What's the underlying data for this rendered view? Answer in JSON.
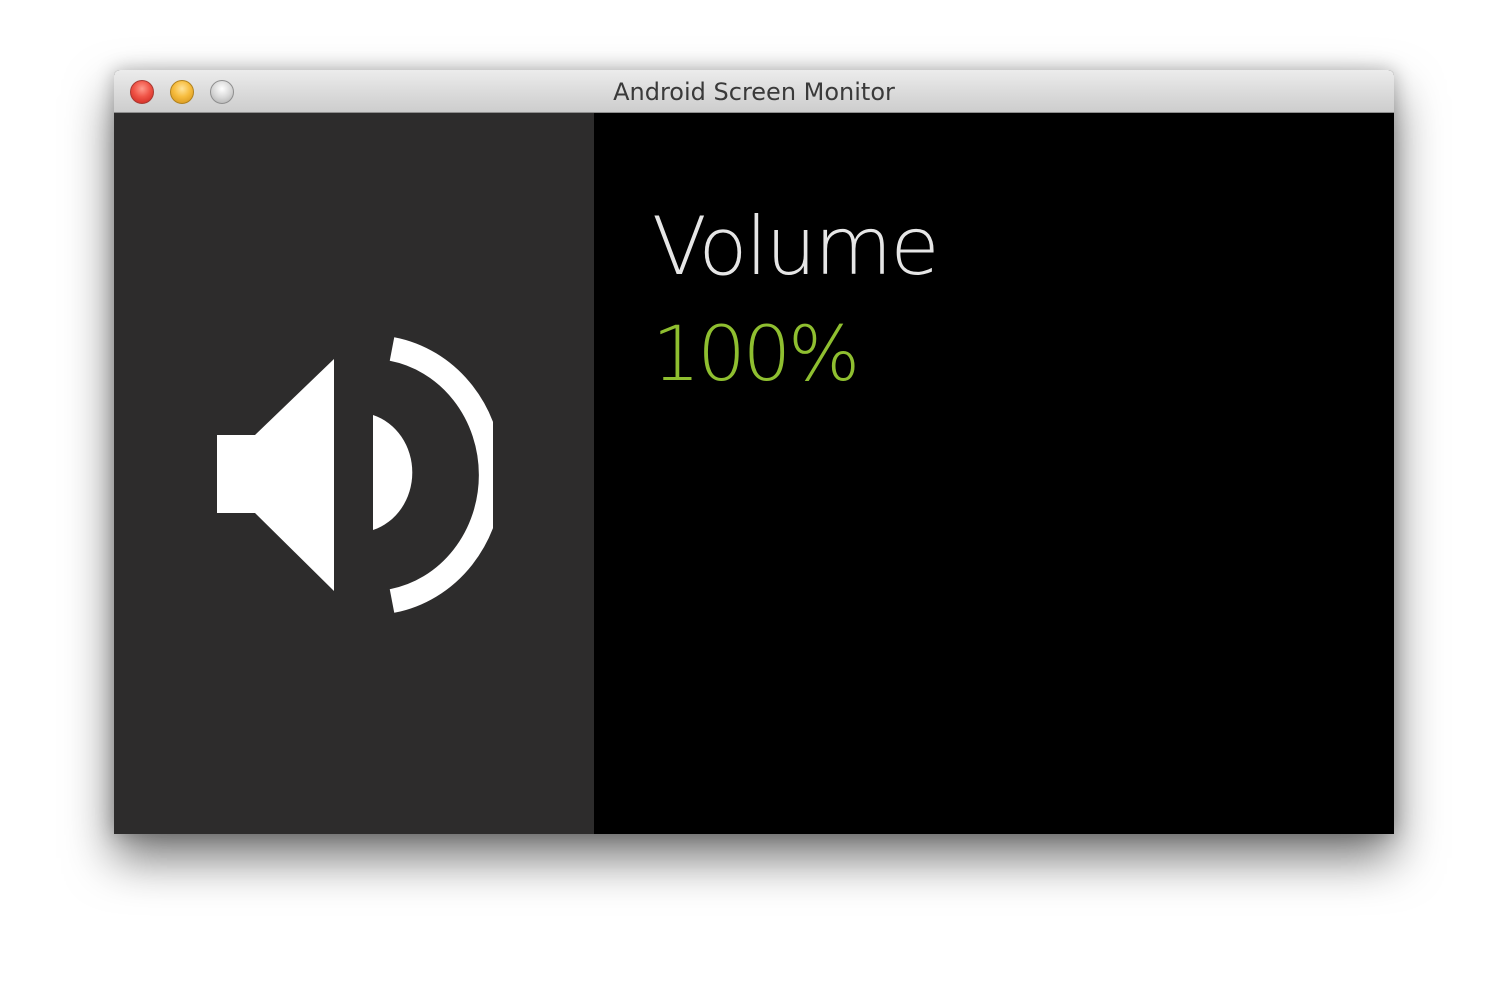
{
  "window": {
    "title": "Android Screen Monitor",
    "controls": {
      "close": "close-button",
      "minimize": "minimize-button",
      "zoom": "zoom-button"
    }
  },
  "card": {
    "icon": "volume-up-icon",
    "heading": "Volume",
    "value": "100%",
    "value_fraction": 1.0
  },
  "colors": {
    "left_panel": "#2d2c2c",
    "right_panel": "#000000",
    "heading": "#e6e6e6",
    "value": "#8fbf30",
    "icon": "#ffffff"
  }
}
